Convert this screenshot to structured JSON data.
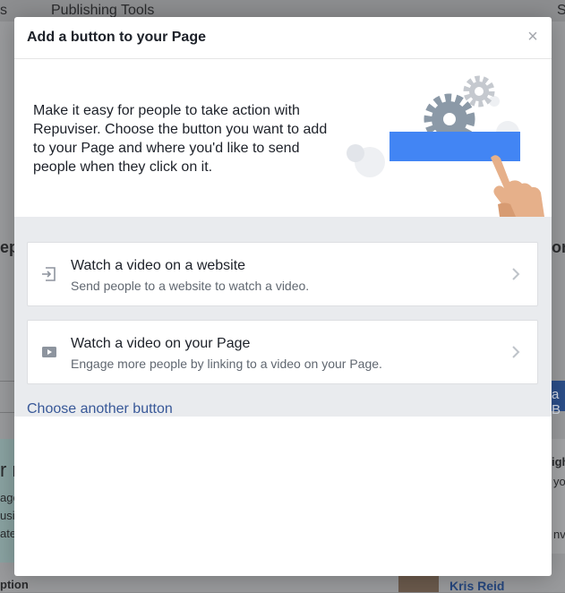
{
  "background": {
    "nav_left_fragment": "s",
    "nav_tab": "Publishing Tools",
    "nav_right_fragment": "S",
    "left_heading_fragment": "ep",
    "right_heading_fragment": "on",
    "right_button_fragment": "a B",
    "left_card_title_fragment": "r n",
    "left_card_lines": [
      "age",
      "usi",
      "ate"
    ],
    "right_card_title_fragment": "igh",
    "right_card_line1": "yo",
    "right_card_line2": "nv",
    "bottom_left_fragment": "ption",
    "bottom_right_name": "Kris Reid"
  },
  "modal": {
    "title": "Add a button to your Page",
    "close_symbol": "×",
    "intro": "Make it easy for people to take action with Repuviser. Choose the button you want to add to your Page and where you'd like to send people when they click on it.",
    "options": [
      {
        "icon": "external-link-icon",
        "title": "Watch a video on a website",
        "description": "Send people to a website to watch a video."
      },
      {
        "icon": "video-play-icon",
        "title": "Watch a video on your Page",
        "description": "Engage more people by linking to a video on your Page."
      }
    ],
    "other_link": "Choose another button"
  },
  "colors": {
    "accent_blue": "#4285f4",
    "link_blue": "#385898",
    "panel_gray": "#e9ebee"
  }
}
